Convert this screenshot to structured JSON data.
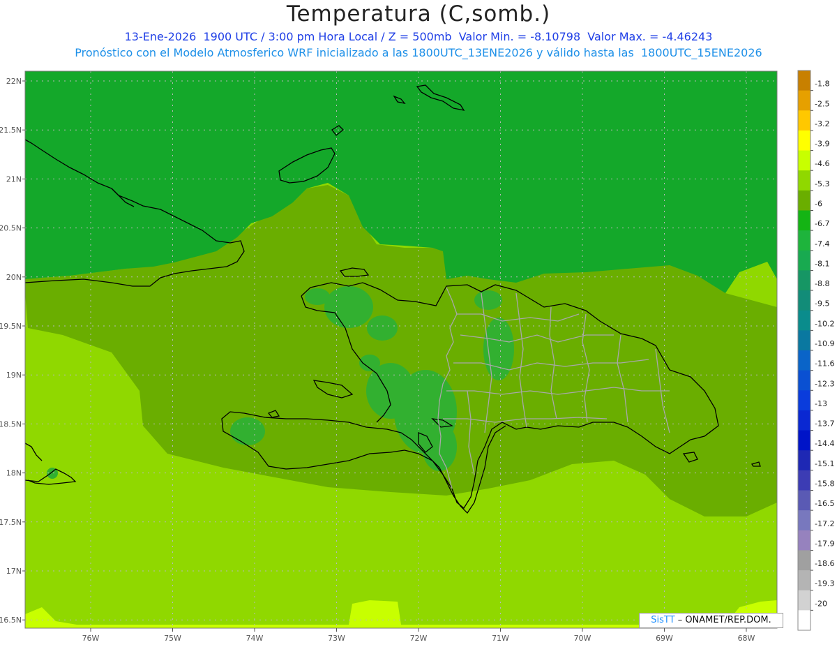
{
  "header": {
    "title": "Temperatura (C,somb.)",
    "subtitle1": "13-Ene-2026  1900 UTC / 3:00 pm Hora Local / Z = 500mb  Valor Min. = -8.10798  Valor Max. = -4.46243",
    "subtitle2": "Pronóstico con el Modelo Atmosferico WRF inicializado a las 1800UTC_13ENE2026 y válido hasta las  1800UTC_15ENE2026"
  },
  "axes": {
    "lat_labels": [
      "22N",
      "21.5N",
      "21N",
      "20.5N",
      "20N",
      "19.5N",
      "19N",
      "18.5N",
      "18N",
      "17.5N",
      "17N",
      "16.5N"
    ],
    "lon_labels": [
      "76W",
      "75W",
      "74W",
      "73W",
      "72W",
      "71W",
      "70W",
      "69W",
      "68W"
    ]
  },
  "colorbar": {
    "labels": [
      "-1.8",
      "-2.5",
      "-3.2",
      "-3.9",
      "-4.6",
      "-5.3",
      "-6",
      "-6.7",
      "-7.4",
      "-8.1",
      "-8.8",
      "-9.5",
      "-10.2",
      "-10.9",
      "-11.6",
      "-12.3",
      "-13",
      "-13.7",
      "-14.4",
      "-15.1",
      "-15.8",
      "-16.5",
      "-17.2",
      "-17.9",
      "-18.6",
      "-19.3",
      "-20"
    ],
    "colors": [
      "#c88000",
      "#e6a000",
      "#ffc800",
      "#ffff00",
      "#c8ff00",
      "#90d800",
      "#6aae00",
      "#14b414",
      "#1eb43c",
      "#18aa50",
      "#169664",
      "#128c78",
      "#0a8c8c",
      "#0a78a0",
      "#0a64c8",
      "#0a50d2",
      "#0a3cdc",
      "#0a28d2",
      "#0014c8",
      "#1e28b4",
      "#3c3cb4",
      "#5a5ab4",
      "#7878be",
      "#9682be",
      "#a0a0a0",
      "#b4b4b4",
      "#d2d2d2",
      "#ffffff"
    ]
  },
  "field_colors": {
    "north_band": "#14a82a",
    "middle_band": "#6aae00",
    "south_band": "#90d800",
    "southern_edge": "#c8ff00",
    "land_patches": "#32b030"
  },
  "credit": {
    "logo": "SisTT",
    "text": " – ONAMET/REP.DOM."
  }
}
